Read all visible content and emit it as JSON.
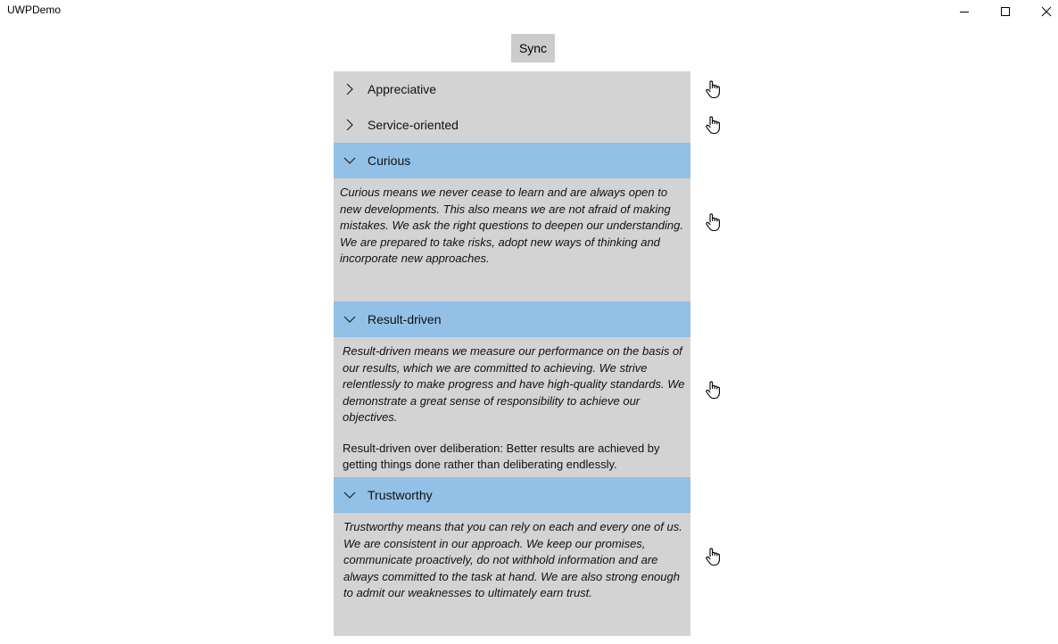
{
  "window": {
    "title": "UWPDemo",
    "controls": [
      "minimize-icon",
      "maximize-icon",
      "close-icon"
    ]
  },
  "toolbar": {
    "sync_label": "Sync"
  },
  "colors": {
    "panel_background": "#d3d3d3",
    "expanded_header": "#92c0e7",
    "sync_button": "#cccccc"
  },
  "sections": [
    {
      "label": "Appreciative",
      "expanded": false
    },
    {
      "label": "Service-oriented",
      "expanded": false
    },
    {
      "label": "Curious",
      "expanded": true,
      "description": "Curious means we never cease to learn and are always open to new developments. This also means we are not afraid of making mistakes. We ask the right questions to deepen our understanding. We are prepared to take risks, adopt new ways of thinking and incorporate new approaches."
    },
    {
      "label": "Result-driven",
      "expanded": true,
      "description": "Result-driven means we measure our performance on the basis of our results, which we are committed to achieving. We strive relentlessly to make progress and have high-quality standards. We demonstrate a great sense of responsibility to achieve our objectives.",
      "note": "Result-driven over deliberation: Better results are achieved by getting things done rather than deliberating endlessly."
    },
    {
      "label": "Trustworthy",
      "expanded": true,
      "description": "Trustworthy means that you can rely on each and every one of us. We are consistent in our approach. We keep our promises, communicate proactively, do not withhold information and are always committed to the task at hand. We are also strong enough to admit our weaknesses to ultimately earn trust."
    }
  ],
  "side_icons": [
    "hand-pointer-icon",
    "hand-pointer-icon",
    "hand-pointer-icon",
    "hand-pointer-icon",
    "hand-pointer-icon"
  ]
}
